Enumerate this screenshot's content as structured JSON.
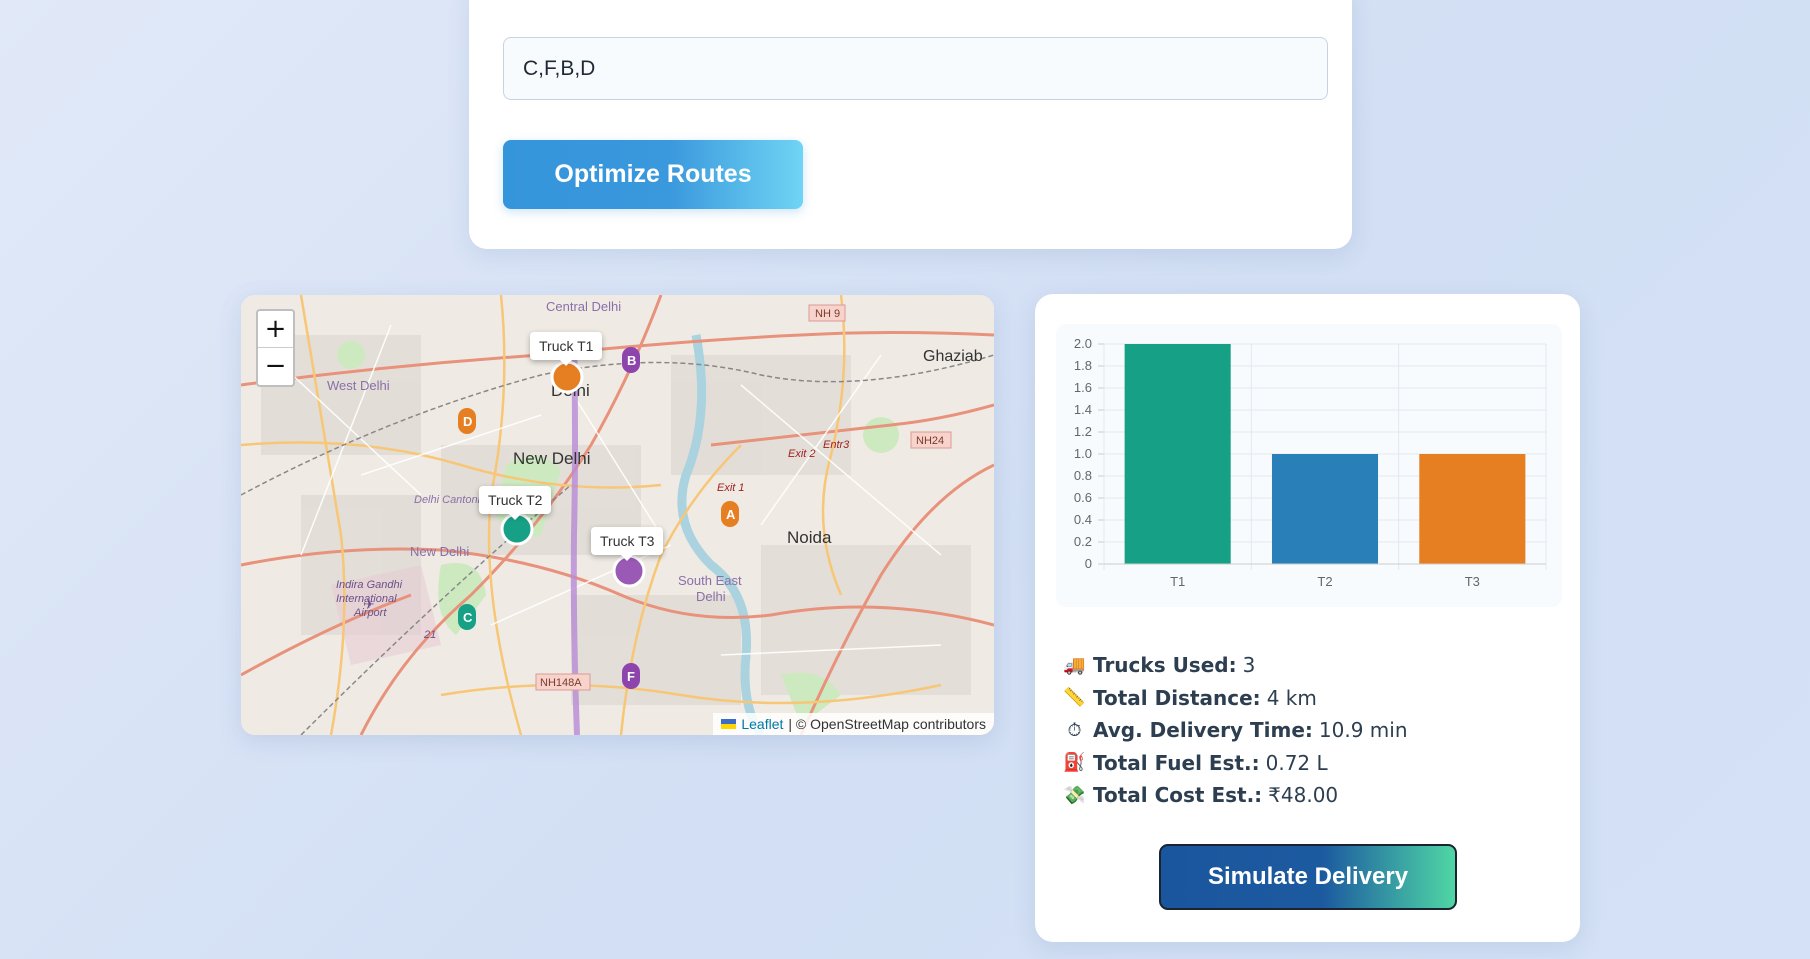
{
  "route_input": {
    "value": "C,F,B,D"
  },
  "optimize_button": {
    "label": "Optimize Routes"
  },
  "map": {
    "zoom_in": "+",
    "zoom_out": "−",
    "place_labels": [
      "Central Delhi",
      "Delhi",
      "New Delhi",
      "West Delhi",
      "Ghaziab",
      "Noida",
      "Delhi Cantonm",
      "New Delhi",
      "South East",
      "Delhi",
      "Indira Gandhi",
      "International",
      "Airport"
    ],
    "road_labels": [
      "NH 9",
      "NH24",
      "NH148A",
      "Exit 2",
      "Entr3",
      "Exit 1",
      "21"
    ],
    "trucks": [
      {
        "label": "Truck T1",
        "color": "#e67e22"
      },
      {
        "label": "Truck T2",
        "color": "#16a085"
      },
      {
        "label": "Truck T3",
        "color": "#9b59b6"
      }
    ],
    "stops": [
      {
        "label": "B",
        "color": "#8e44ad"
      },
      {
        "label": "D",
        "color": "#e67e22"
      },
      {
        "label": "A",
        "color": "#e67e22"
      },
      {
        "label": "C",
        "color": "#16a085"
      },
      {
        "label": "F",
        "color": "#8e44ad"
      }
    ],
    "attribution": {
      "link": "Leaflet",
      "text": "| © OpenStreetMap contributors"
    }
  },
  "chart_data": {
    "type": "bar",
    "categories": [
      "T1",
      "T2",
      "T3"
    ],
    "values": [
      2,
      1,
      1
    ],
    "colors": [
      "#16a085",
      "#2980b9",
      "#e67e22"
    ],
    "ylim": [
      0,
      2
    ],
    "yticks": [
      "0",
      "0.2",
      "0.4",
      "0.6",
      "0.8",
      "1.0",
      "1.2",
      "1.4",
      "1.6",
      "1.8",
      "2.0"
    ],
    "grid": true,
    "legend": "none"
  },
  "stats": [
    {
      "icon": "🚚",
      "icon_name": "truck-icon",
      "label": "Trucks Used:",
      "value": "3"
    },
    {
      "icon": "📏",
      "icon_name": "ruler-icon",
      "label": "Total Distance:",
      "value": "4 km"
    },
    {
      "icon": "⏱",
      "icon_name": "stopwatch-icon",
      "label": "Avg. Delivery Time:",
      "value": "10.9 min"
    },
    {
      "icon": "⛽",
      "icon_name": "fuel-icon",
      "label": "Total Fuel Est.:",
      "value": "0.72 L"
    },
    {
      "icon": "💸",
      "icon_name": "money-icon",
      "label": "Total Cost Est.:",
      "value": "₹48.00"
    }
  ],
  "simulate_button": {
    "label": "Simulate Delivery"
  }
}
